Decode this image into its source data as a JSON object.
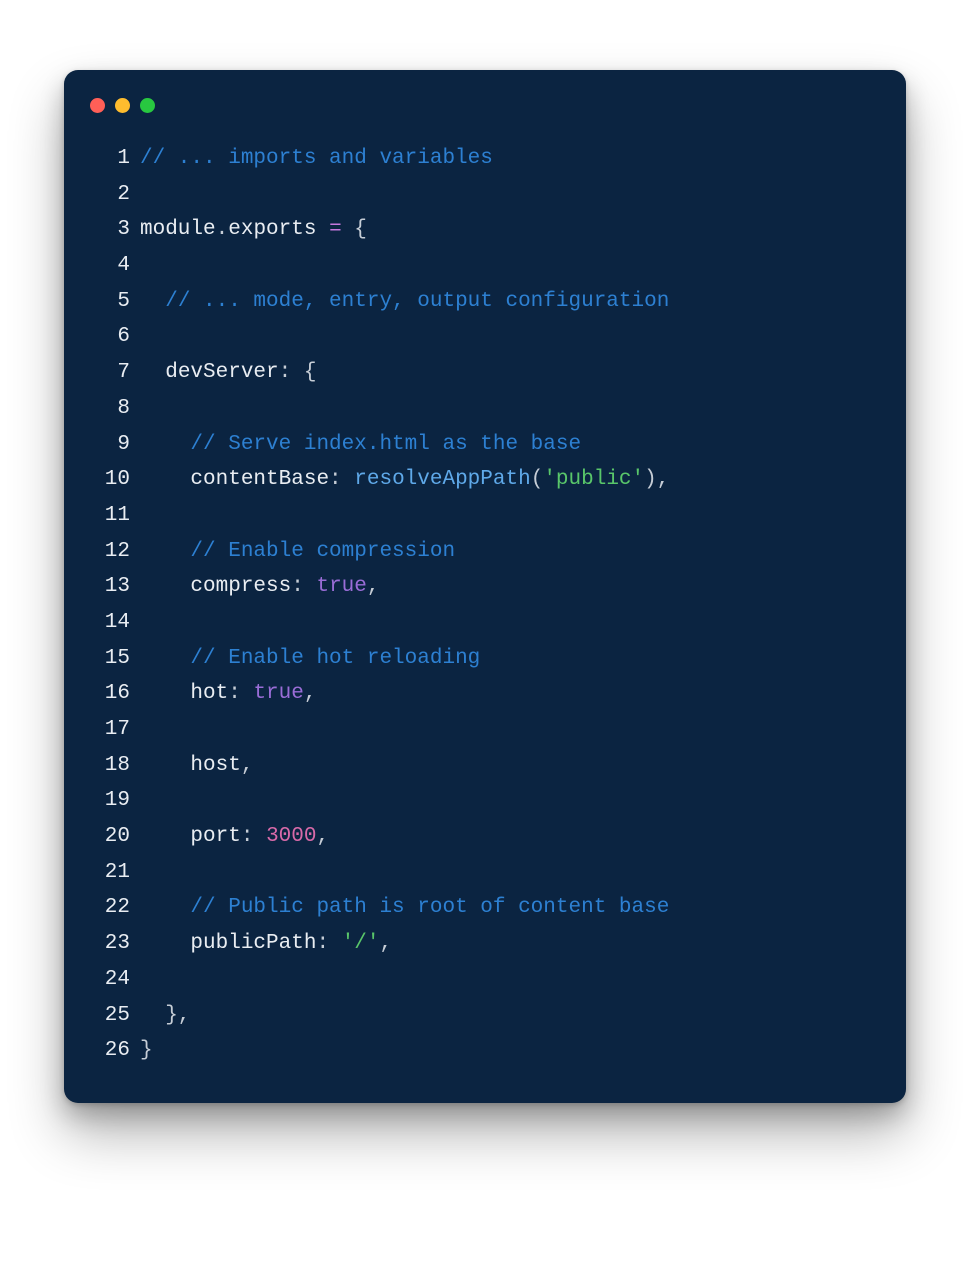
{
  "window": {
    "dot_colors": {
      "close": "#ff5f57",
      "minimize": "#febc2e",
      "zoom": "#28c840"
    }
  },
  "code": {
    "lines": [
      {
        "n": 1,
        "tokens": [
          {
            "c": "tok-comment",
            "t": "// ... imports and variables"
          }
        ]
      },
      {
        "n": 2,
        "tokens": []
      },
      {
        "n": 3,
        "tokens": [
          {
            "c": "tok-ident",
            "t": "module"
          },
          {
            "c": "tok-punct",
            "t": "."
          },
          {
            "c": "tok-ident",
            "t": "exports"
          },
          {
            "c": "tok-punct",
            "t": " "
          },
          {
            "c": "tok-keyword",
            "t": "="
          },
          {
            "c": "tok-punct",
            "t": " {"
          }
        ]
      },
      {
        "n": 4,
        "tokens": []
      },
      {
        "n": 5,
        "tokens": [
          {
            "c": "tok-punct",
            "t": "  "
          },
          {
            "c": "tok-comment",
            "t": "// ... mode, entry, output configuration"
          }
        ]
      },
      {
        "n": 6,
        "tokens": []
      },
      {
        "n": 7,
        "tokens": [
          {
            "c": "tok-punct",
            "t": "  "
          },
          {
            "c": "tok-ident",
            "t": "devServer"
          },
          {
            "c": "tok-punct",
            "t": ": {"
          }
        ]
      },
      {
        "n": 8,
        "tokens": []
      },
      {
        "n": 9,
        "tokens": [
          {
            "c": "tok-punct",
            "t": "    "
          },
          {
            "c": "tok-comment",
            "t": "// Serve index.html as the base"
          }
        ]
      },
      {
        "n": 10,
        "tokens": [
          {
            "c": "tok-punct",
            "t": "    "
          },
          {
            "c": "tok-ident",
            "t": "contentBase"
          },
          {
            "c": "tok-punct",
            "t": ": "
          },
          {
            "c": "tok-call",
            "t": "resolveAppPath"
          },
          {
            "c": "tok-punct",
            "t": "("
          },
          {
            "c": "tok-string",
            "t": "'public'"
          },
          {
            "c": "tok-punct",
            "t": "),"
          }
        ]
      },
      {
        "n": 11,
        "tokens": []
      },
      {
        "n": 12,
        "tokens": [
          {
            "c": "tok-punct",
            "t": "    "
          },
          {
            "c": "tok-comment",
            "t": "// Enable compression"
          }
        ]
      },
      {
        "n": 13,
        "tokens": [
          {
            "c": "tok-punct",
            "t": "    "
          },
          {
            "c": "tok-ident",
            "t": "compress"
          },
          {
            "c": "tok-punct",
            "t": ": "
          },
          {
            "c": "tok-bool",
            "t": "true"
          },
          {
            "c": "tok-punct",
            "t": ","
          }
        ]
      },
      {
        "n": 14,
        "tokens": []
      },
      {
        "n": 15,
        "tokens": [
          {
            "c": "tok-punct",
            "t": "    "
          },
          {
            "c": "tok-comment",
            "t": "// Enable hot reloading"
          }
        ]
      },
      {
        "n": 16,
        "tokens": [
          {
            "c": "tok-punct",
            "t": "    "
          },
          {
            "c": "tok-ident",
            "t": "hot"
          },
          {
            "c": "tok-punct",
            "t": ": "
          },
          {
            "c": "tok-bool",
            "t": "true"
          },
          {
            "c": "tok-punct",
            "t": ","
          }
        ]
      },
      {
        "n": 17,
        "tokens": []
      },
      {
        "n": 18,
        "tokens": [
          {
            "c": "tok-punct",
            "t": "    "
          },
          {
            "c": "tok-ident",
            "t": "host"
          },
          {
            "c": "tok-punct",
            "t": ","
          }
        ]
      },
      {
        "n": 19,
        "tokens": []
      },
      {
        "n": 20,
        "tokens": [
          {
            "c": "tok-punct",
            "t": "    "
          },
          {
            "c": "tok-ident",
            "t": "port"
          },
          {
            "c": "tok-punct",
            "t": ": "
          },
          {
            "c": "tok-number",
            "t": "3000"
          },
          {
            "c": "tok-punct",
            "t": ","
          }
        ]
      },
      {
        "n": 21,
        "tokens": []
      },
      {
        "n": 22,
        "tokens": [
          {
            "c": "tok-punct",
            "t": "    "
          },
          {
            "c": "tok-comment",
            "t": "// Public path is root of content base"
          }
        ]
      },
      {
        "n": 23,
        "tokens": [
          {
            "c": "tok-punct",
            "t": "    "
          },
          {
            "c": "tok-ident",
            "t": "publicPath"
          },
          {
            "c": "tok-punct",
            "t": ": "
          },
          {
            "c": "tok-string",
            "t": "'/'"
          },
          {
            "c": "tok-punct",
            "t": ","
          }
        ]
      },
      {
        "n": 24,
        "tokens": []
      },
      {
        "n": 25,
        "tokens": [
          {
            "c": "tok-punct",
            "t": "  },"
          }
        ]
      },
      {
        "n": 26,
        "tokens": [
          {
            "c": "tok-punct",
            "t": "}"
          }
        ]
      }
    ]
  }
}
